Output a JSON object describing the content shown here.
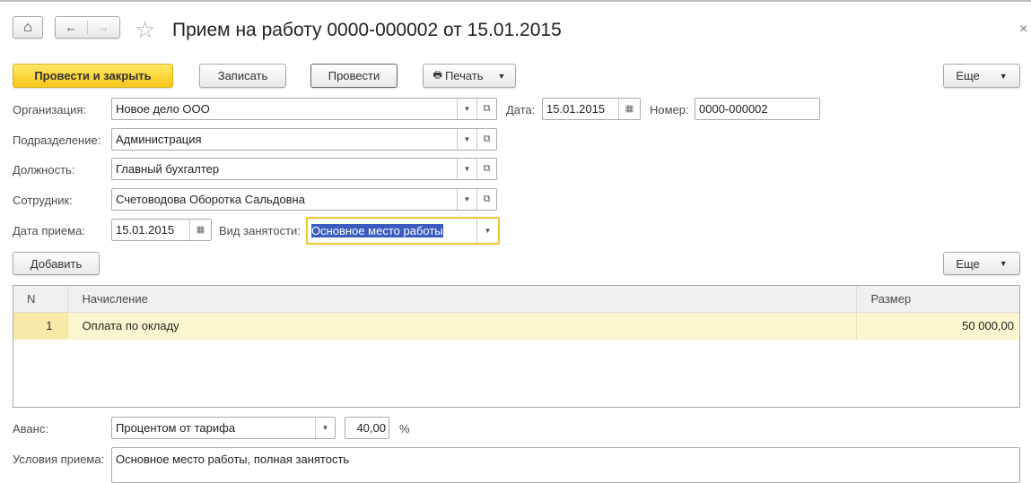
{
  "title": "Прием на работу 0000-000002 от 15.01.2015",
  "nav": {
    "home": "⌂",
    "back": "←",
    "forward": "→",
    "star": "☆",
    "close": "×"
  },
  "toolbar": {
    "post_close": "Провести и закрыть",
    "save": "Записать",
    "post": "Провести",
    "print": "Печать",
    "more": "Еще"
  },
  "fields": {
    "org_label": "Организация:",
    "org": "Новое дело ООО",
    "date_label": "Дата:",
    "date": "15.01.2015",
    "num_label": "Номер:",
    "num": "0000-000002",
    "dept_label": "Подразделение:",
    "dept": "Администрация",
    "pos_label": "Должность:",
    "pos": "Главный бухгалтер",
    "emp_label": "Сотрудник:",
    "emp": "Счетоводова Оборотка Сальдовна",
    "hire_label": "Дата приема:",
    "hire": "15.01.2015",
    "kind_label": "Вид занятости:",
    "kind": "Основное место работы"
  },
  "table_toolbar": {
    "add": "Добавить",
    "more": "Еще"
  },
  "table": {
    "headers": [
      "N",
      "Начисление",
      "Размер"
    ],
    "rows": [
      {
        "n": "1",
        "name": "Оплата по окладу",
        "size": "50 000,00"
      }
    ]
  },
  "advance": {
    "label": "Аванс:",
    "mode": "Процентом от тарифа",
    "value": "40,00",
    "unit": "%"
  },
  "conditions": {
    "label": "Условия приема:",
    "value": "Основное место работы, полная занятость"
  },
  "colors": {
    "accent": "#f7c71a",
    "selection": "#3a5bbf",
    "row": "#fcf6d0"
  }
}
